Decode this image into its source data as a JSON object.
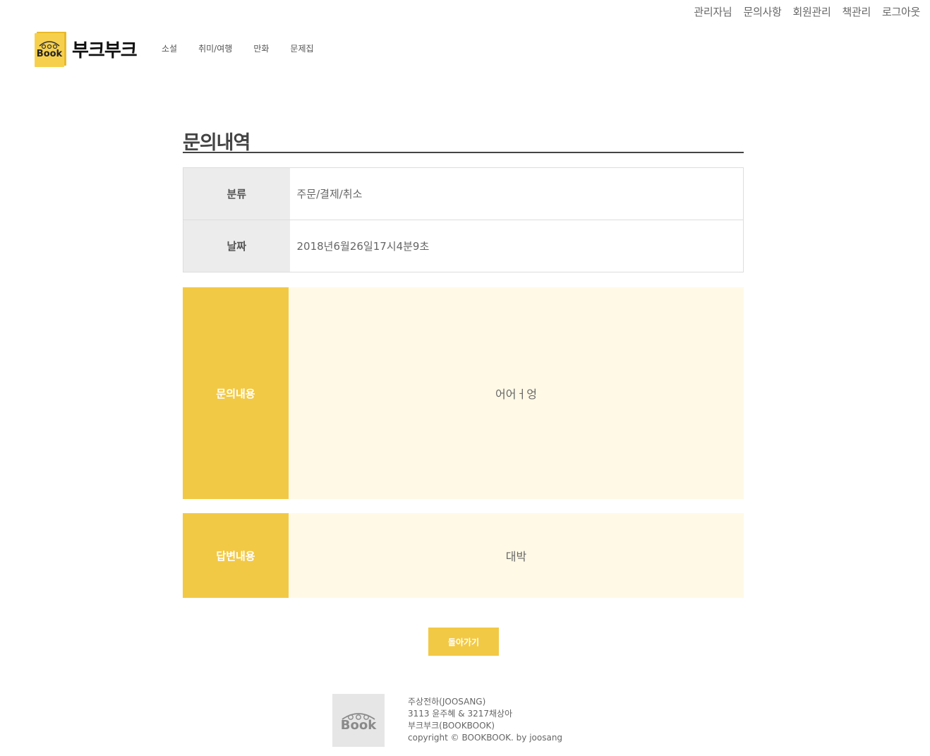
{
  "top_links": [
    "관리자님",
    "문의사항",
    "회원관리",
    "책관리",
    "로그아웃"
  ],
  "brand": {
    "name": "부크부크",
    "logo_text": "Book"
  },
  "nav": [
    "소설",
    "취미/여행",
    "만화",
    "문제집"
  ],
  "page_title": "문의내역",
  "info": {
    "category_label": "분류",
    "category_value": "주문/결제/취소",
    "date_label": "날짜",
    "date_value": "2018년6월26일17시4분9초"
  },
  "inquiry": {
    "label": "문의내용",
    "content": "어어ㅓ엉"
  },
  "answer": {
    "label": "답변내용",
    "content": "대박"
  },
  "back_button": "돌아가기",
  "footer": {
    "logo_text": "Book",
    "lines": [
      "주상전하(JOOSANG)",
      "3113 윤주혜 & 3217채상아",
      "부크부크(BOOKBOOK)",
      "copyright © BOOKBOOK. by joosang"
    ]
  },
  "colors": {
    "accent": "#f2c945",
    "content_bg": "#fff9e6",
    "header_cell_bg": "#ececec"
  }
}
